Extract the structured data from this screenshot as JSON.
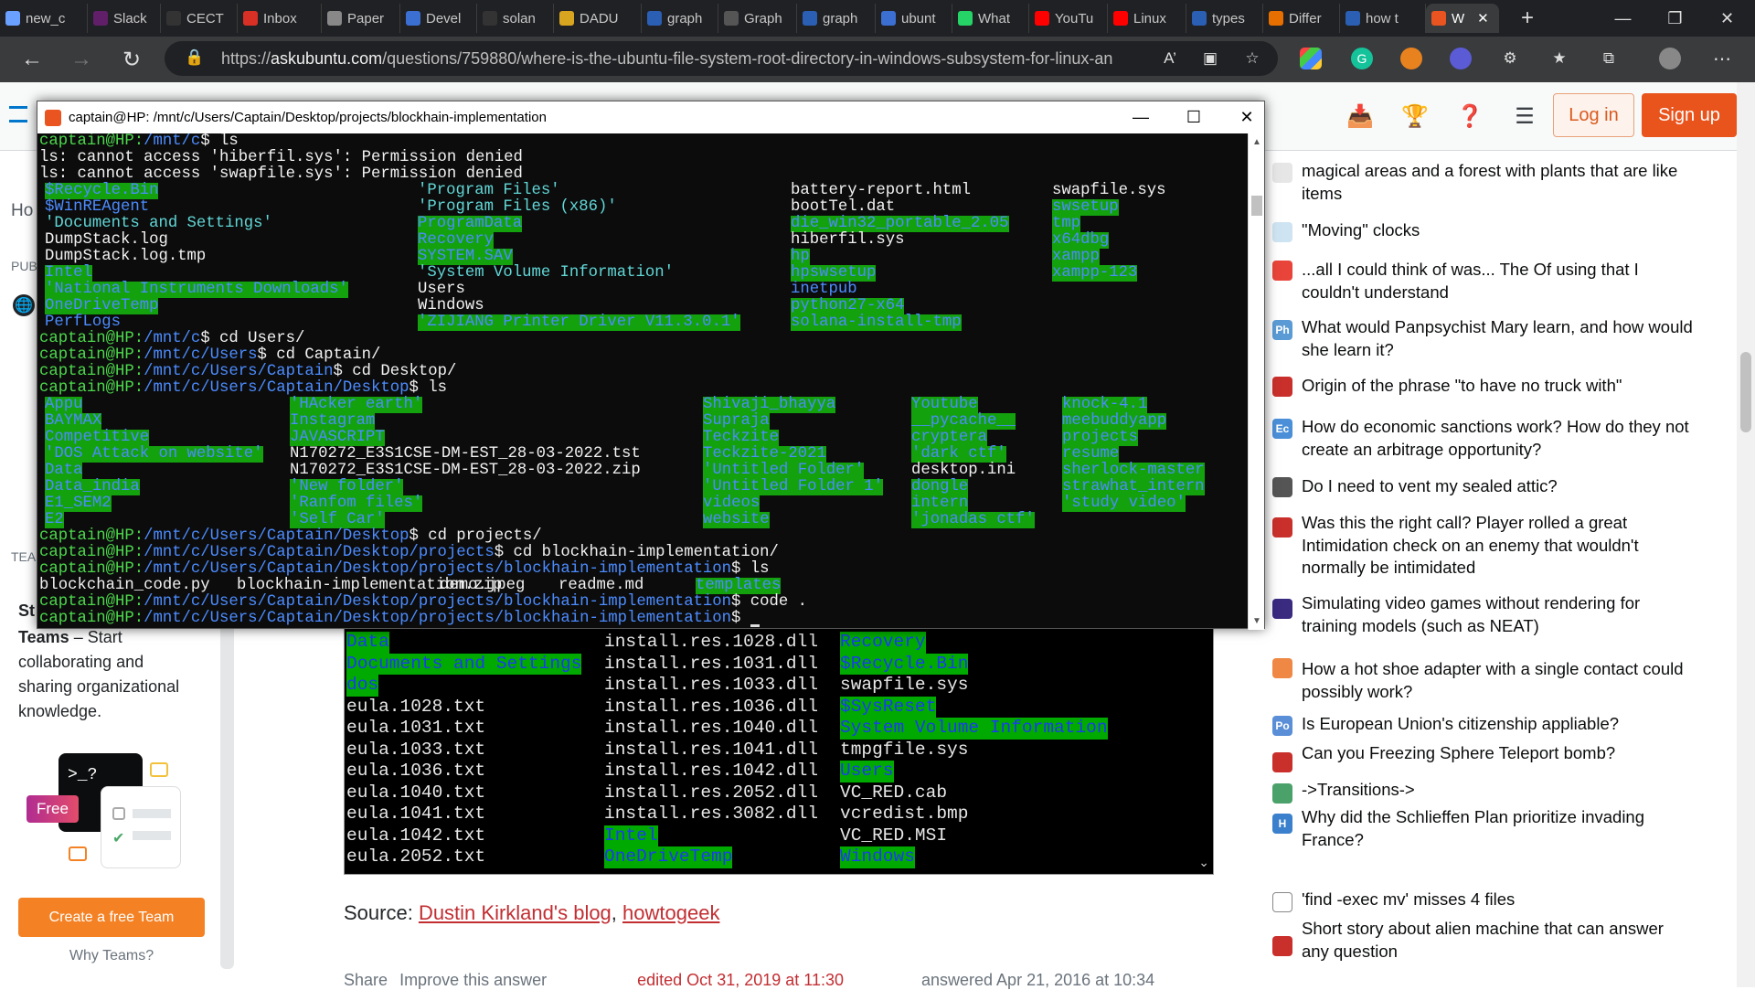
{
  "tabs": [
    {
      "label": "new_c",
      "icon": "tab-icon",
      "x": 0
    },
    {
      "label": "Slack",
      "icon": "slack-icon",
      "x": 0
    },
    {
      "label": "CECT",
      "icon": "github-icon",
      "x": 0
    },
    {
      "label": "Inbox",
      "icon": "gmail-icon",
      "x": 0
    },
    {
      "label": "Paper",
      "icon": "doc-icon",
      "x": 0
    },
    {
      "label": "Devel",
      "icon": "stack-icon",
      "x": 0
    },
    {
      "label": "solan",
      "icon": "github-icon",
      "x": 0
    },
    {
      "label": "DADU",
      "icon": "link-icon",
      "x": 0
    },
    {
      "label": "graph",
      "icon": "search-icon",
      "x": 0
    },
    {
      "label": "Graph",
      "icon": "dsc-icon",
      "x": 0
    },
    {
      "label": "graph",
      "icon": "search-icon",
      "x": 0
    },
    {
      "label": "ubunt",
      "icon": "brace-icon",
      "x": 0
    },
    {
      "label": "What",
      "icon": "whatsapp-icon",
      "x": 0
    },
    {
      "label": "YouTu",
      "icon": "youtube-icon",
      "x": 0
    },
    {
      "label": "Linux",
      "icon": "youtube-icon",
      "x": 0
    },
    {
      "label": "types",
      "icon": "search-icon",
      "x": 0
    },
    {
      "label": "Differ",
      "icon": "java-icon",
      "x": 0
    },
    {
      "label": "how t",
      "icon": "search-icon",
      "x": 0
    },
    {
      "label": "W",
      "icon": "askubuntu-icon",
      "x": 0
    }
  ],
  "browser": {
    "url_prefix": "https://",
    "url_domain": "askubuntu.com",
    "url_path": "/questions/759880/where-is-the-ubuntu-file-system-root-directory-in-windows-subsystem-for-linux-an"
  },
  "header": {
    "login": "Log in",
    "signup": "Sign up"
  },
  "left": {
    "ho": "Ho",
    "pub": "PUB",
    "tea": "TEA",
    "teams_title_1": "St",
    "teams_title_2": "Teams",
    "teams_desc_1": " – Start",
    "teams_desc_2": "collaborating and",
    "teams_desc_3": "sharing organizational",
    "teams_desc_4": "knowledge.",
    "free_badge": "Free",
    "prompt_glyph": ">_?",
    "create_team": "Create a free Team",
    "why_teams": "Why Teams?"
  },
  "terminal": {
    "title": "captain@HP: /mnt/c/Users/Captain/Desktop/projects/blockhain-implementation"
  },
  "answer": {
    "source_label": "Source: ",
    "source_link1": "Dustin Kirkland's blog",
    "source_sep": ", ",
    "source_link2": "howtogeek",
    "share": "Share",
    "improve": "Improve this answer",
    "edited": "edited Oct 31, 2019 at 11:30",
    "answered": "answered Apr 21, 2016 at 10:34",
    "shot_col1": [
      "Data",
      "Documents and Settings",
      "dos",
      "eula.1028.txt",
      "eula.1031.txt",
      "eula.1033.txt",
      "eula.1036.txt",
      "eula.1040.txt",
      "eula.1041.txt",
      "eula.1042.txt",
      "eula.2052.txt"
    ],
    "shot_col2": [
      "install.res.1028.dll",
      "install.res.1031.dll",
      "install.res.1033.dll",
      "install.res.1036.dll",
      "install.res.1040.dll",
      "install.res.1041.dll",
      "install.res.1042.dll",
      "install.res.2052.dll",
      "install.res.3082.dll",
      "Intel",
      "OneDriveTemp"
    ],
    "shot_col3": [
      "Recovery",
      "$Recycle.Bin",
      "swapfile.sys",
      "$SysReset",
      "System Volume Information",
      "tmpgfile.sys",
      "Users",
      "VC_RED.cab",
      "vcredist.bmp",
      "VC_RED.MSI",
      "Windows"
    ]
  },
  "hot_questions": [
    {
      "text": "magical areas and a forest with plants that are like items"
    },
    {
      "text": "\"Moving\" clocks"
    },
    {
      "text": "...all I could think of was... The Of using that I couldn't understand"
    },
    {
      "text": "What would Panpsychist Mary learn, and how would she learn it?"
    },
    {
      "text": "Origin of the phrase \"to have no truck with\""
    },
    {
      "text": "How do economic sanctions work? How do they not create an arbitrage opportunity?"
    },
    {
      "text": "Do I need to vent my sealed attic?"
    },
    {
      "text": "Was this the right call? Player rolled a great Intimidation check on an enemy that wouldn't normally be intimidated"
    },
    {
      "text": "Simulating video games without rendering for training models (such as NEAT)"
    },
    {
      "text": "How a hot shoe adapter with a single contact could possibly work?"
    },
    {
      "text": "Is European Union's citizenship appliable?"
    },
    {
      "text": "Can you Freezing Sphere Teleport bomb?"
    },
    {
      "text": "->Transitions->"
    },
    {
      "text": "Why did the Schlieffen Plan prioritize invading France?"
    },
    {
      "text": "'find -exec mv' misses 4 files"
    },
    {
      "text": "Short story about alien machine that can answer any question"
    }
  ],
  "hot_icon_labels": [
    "Ph",
    "Ec",
    "Po",
    "H"
  ],
  "term_lines": [
    "captain@HP:/mnt/c$ ls",
    "ls: cannot access 'hiberfil.sys': Permission denied",
    "ls: cannot access 'swapfile.sys': Permission denied",
    "captain@HP:/mnt/c$ cd Users/",
    "captain@HP:/mnt/c/Users$ cd Captain/",
    "captain@HP:/mnt/c/Users/Captain$ cd Desktop/",
    "captain@HP:/mnt/c/Users/Captain/Desktop$ ls",
    "captain@HP:/mnt/c/Users/Captain/Desktop$ cd projects/",
    "captain@HP:/mnt/c/Users/Captain/Desktop/projects$ cd blockhain-implementation/",
    "captain@HP:/mnt/c/Users/Captain/Desktop/projects/blockhain-implementation$ ls",
    "captain@HP:/mnt/c/Users/Captain/Desktop/projects/blockhain-implementation$ code .",
    "captain@HP:/mnt/c/Users/Captain/Desktop/projects/blockhain-implementation$ "
  ],
  "c_listing": [
    [
      "$Recycle.Bin",
      "'Program Files'",
      "battery-report.html",
      "swapfile.sys"
    ],
    [
      "$WinREAgent",
      "'Program Files (x86)'",
      "bootTel.dat",
      "swsetup"
    ],
    [
      "'Documents and Settings'",
      "ProgramData",
      "die_win32_portable_2.05",
      "tmp"
    ],
    [
      "DumpStack.log",
      "Recovery",
      "hiberfil.sys",
      "x64dbg"
    ],
    [
      "DumpStack.log.tmp",
      "SYSTEM.SAV",
      "hp",
      "xampp"
    ],
    [
      "Intel",
      "'System Volume Information'",
      "hpswsetup",
      "xampp-123"
    ],
    [
      "'National Instruments Downloads'",
      "Users",
      "inetpub",
      ""
    ],
    [
      "OneDriveTemp",
      "Windows",
      "python27-x64",
      ""
    ],
    [
      "PerfLogs",
      "'ZIJIANG Printer Driver V11.3.0.1'",
      "solana-install-tmp",
      ""
    ]
  ],
  "desktop_listing": [
    [
      "Appu",
      "'HAcker earth'",
      "Shivaji_bhayya",
      "Youtube",
      "knock-4.1"
    ],
    [
      "BAYMAX",
      "Instagram",
      "Supraja",
      "__pycache__",
      "meebuddyapp"
    ],
    [
      "Competitive",
      "JAVASCRIPT",
      "Teckzite",
      "cryptera",
      "projects"
    ],
    [
      "'DOS Attack on website'",
      "N170272_E3S1CSE-DM-EST_28-03-2022.tst",
      "Teckzite-2021",
      "'dark ctf'",
      "resume"
    ],
    [
      "Data",
      "N170272_E3S1CSE-DM-EST_28-03-2022.zip",
      "'Untitled Folder'",
      "desktop.ini",
      "sherlock-master"
    ],
    [
      "Data_india",
      "'New folder'",
      "'Untitled Folder 1'",
      "dongle",
      "strawhat_intern"
    ],
    [
      "E1_SEM2",
      "'Ranfom files'",
      "videos",
      "intern",
      "'study video'"
    ],
    [
      "E2",
      "'Self Car'",
      "website",
      "'jonadas ctf'",
      ""
    ]
  ],
  "project_listing": [
    "blockchain_code.py",
    "blockhain-implementation.zip",
    "demo.jpeg",
    "readme.md",
    "templates"
  ]
}
